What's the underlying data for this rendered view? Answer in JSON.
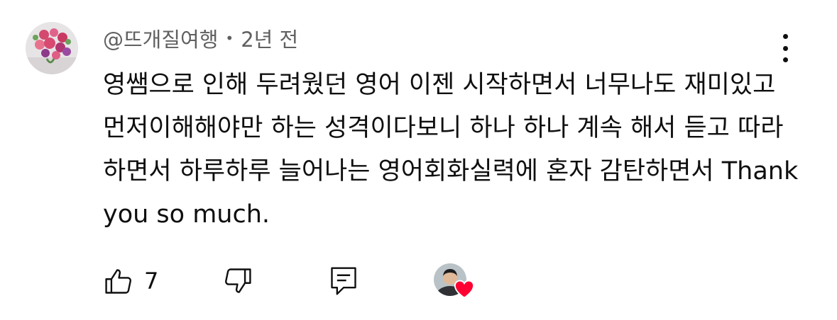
{
  "comment": {
    "author": "@뜨개질여행",
    "separator": "•",
    "time_ago": "2년 전",
    "text": "영쌤으로 인해 두려웠던 영어 이젠 시작하면서 너무나도 재미있고 먼저이해해야만 하는 성격이다보니 하나 하나 계속 해서 듣고 따라하면서 하루하루 늘어나는 영어회화실력에 혼자 감탄하면서 Thank you so much."
  },
  "actions": {
    "like_count": "7"
  },
  "icons": {
    "avatar": "flower-bouquet-avatar",
    "menu": "more-vertical-icon",
    "like": "thumbs-up-icon",
    "dislike": "thumbs-down-icon",
    "reply": "reply-comment-icon",
    "creator": "creator-avatar",
    "heart": "heart-icon"
  },
  "colors": {
    "text": "#0f0f0f",
    "meta": "#606060",
    "heart": "#ff0033"
  }
}
